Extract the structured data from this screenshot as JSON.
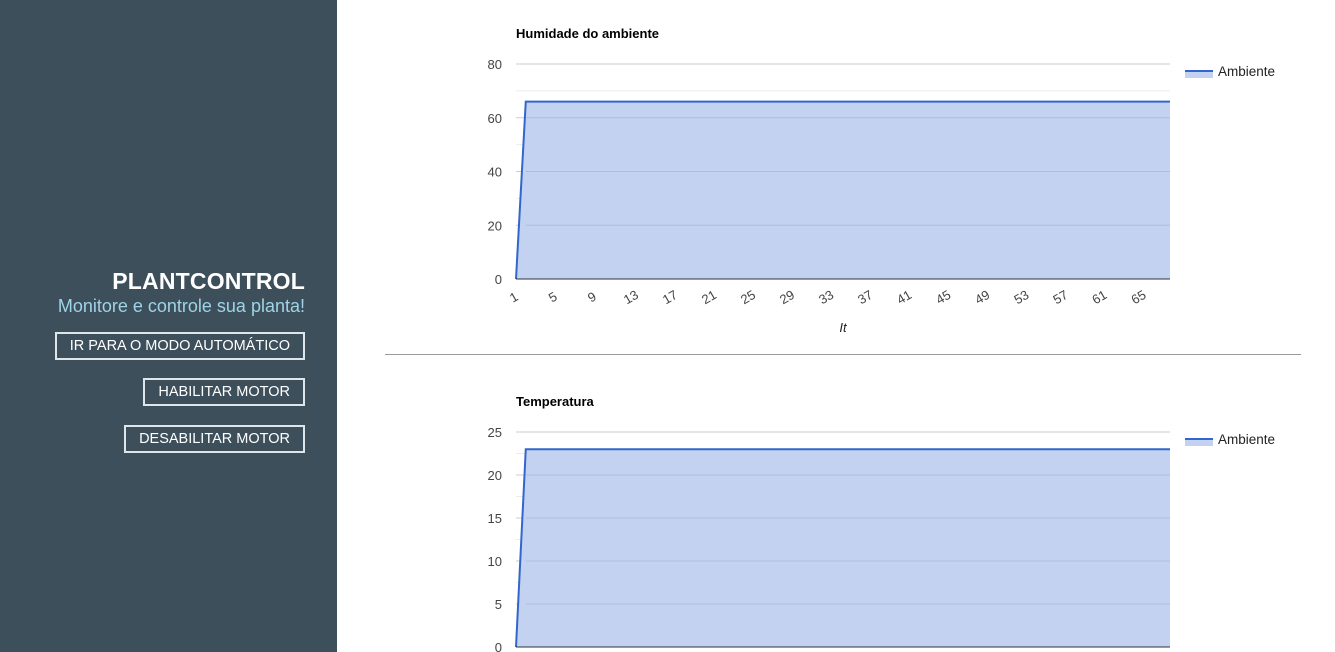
{
  "sidebar": {
    "title": "PLANTCONTROL",
    "subtitle": "Monitore e controle sua planta!",
    "buttons": [
      {
        "label": "IR PARA O MODO AUTOMÁTICO"
      },
      {
        "label": "HABILITAR MOTOR"
      },
      {
        "label": "DESABILITAR MOTOR"
      }
    ]
  },
  "colors": {
    "sidebar_bg": "#3e4f5c",
    "series_line": "#3366cc",
    "series_fill": "#c2d2f0"
  },
  "chart_data": [
    {
      "type": "area",
      "title": "Humidade do ambiente",
      "xlabel": "It",
      "ylabel": "",
      "ylim": [
        0,
        80
      ],
      "yticks": [
        0,
        20,
        40,
        60,
        80
      ],
      "xlim": [
        1,
        68
      ],
      "xticks": [
        1,
        5,
        9,
        13,
        17,
        21,
        25,
        29,
        33,
        37,
        41,
        45,
        49,
        53,
        57,
        61,
        65
      ],
      "legend_position": "right",
      "series": [
        {
          "name": "Ambiente",
          "x": [
            1,
            2,
            68
          ],
          "values": [
            0,
            66,
            66
          ]
        }
      ]
    },
    {
      "type": "area",
      "title": "Temperatura",
      "xlabel": "",
      "ylabel": "",
      "ylim": [
        0,
        25
      ],
      "yticks": [
        0,
        5,
        10,
        15,
        20,
        25
      ],
      "xlim": [
        1,
        68
      ],
      "legend_position": "right",
      "series": [
        {
          "name": "Ambiente",
          "x": [
            1,
            2,
            68
          ],
          "values": [
            0,
            23,
            23
          ]
        }
      ]
    }
  ]
}
